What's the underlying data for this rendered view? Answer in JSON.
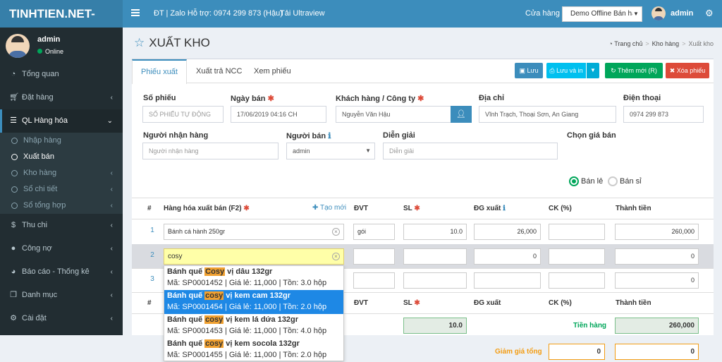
{
  "topbar": {
    "logo": "TINHTIEN.NET-Sales",
    "hotline": "ĐT | Zalo Hỗ trợ: 0974 299 873 (Hậu)",
    "ultraview": "Tải Ultraview",
    "store_label": "Cửa hàng",
    "store_value": "Demo Offline Bán hàn",
    "user": "admin"
  },
  "sidebar": {
    "user_name": "admin",
    "user_status": "Online",
    "menu": [
      {
        "label": "Tổng quan",
        "icon": "dashboard-icon"
      },
      {
        "label": "Đặt hàng",
        "icon": "cart-icon"
      },
      {
        "label": "QL Hàng hóa",
        "icon": "list-icon"
      },
      {
        "label": "Thu chi",
        "icon": "dollar-icon"
      },
      {
        "label": "Công nợ",
        "icon": "users-icon"
      },
      {
        "label": "Báo cáo - Thống kê",
        "icon": "pie-chart-icon"
      },
      {
        "label": "Danh mục",
        "icon": "copy-icon"
      },
      {
        "label": "Cài đặt",
        "icon": "gear-icon"
      }
    ],
    "submenu": [
      "Nhập hàng",
      "Xuất bán",
      "Kho hàng",
      "Sổ chi tiết",
      "Sổ tổng hợp"
    ]
  },
  "page": {
    "title": "XUẤT KHO",
    "breadcrumb": [
      "Trang chủ",
      "Kho hàng",
      "Xuất kho"
    ]
  },
  "tabs": [
    "Phiếu xuất",
    "Xuất trả NCC",
    "Xem phiếu"
  ],
  "buttons": {
    "save": "Lưu",
    "save_print": "Lưu và in",
    "add_new": "Thêm mới (R)",
    "delete": "Xóa phiếu"
  },
  "form": {
    "so_phieu": {
      "label": "Số phiếu",
      "placeholder": "SỐ PHIẾU TỰ ĐỘNG"
    },
    "ngay_ban": {
      "label": "Ngày bán",
      "value": "17/06/2019 04:16 CH"
    },
    "khach_hang": {
      "label": "Khách hàng / Công ty",
      "value": "Nguyễn Văn Hậu"
    },
    "dia_chi": {
      "label": "Địa chỉ",
      "value": "Vĩnh Trạch, Thoại Sơn, An Giang"
    },
    "dien_thoai": {
      "label": "Điện thoại",
      "value": "0974 299 873"
    },
    "nguoi_nhan": {
      "label": "Người nhận hàng",
      "placeholder": "Người nhận hàng"
    },
    "nguoi_ban": {
      "label": "Người bán",
      "value": "admin"
    },
    "dien_giai": {
      "label": "Diễn giải",
      "placeholder": "Diễn giải"
    },
    "chon_gia": {
      "label": "Chọn giá bán",
      "options": [
        "Bán lẻ",
        "Bán sỉ"
      ],
      "selected": "Bán lẻ"
    }
  },
  "table": {
    "headers": {
      "num": "#",
      "product": "Hàng hóa xuất bán (F2)",
      "add_link": "Tạo mới",
      "unit": "ĐVT",
      "qty": "SL",
      "price": "ĐG xuất",
      "discount": "CK (%)",
      "total": "Thành tiền"
    },
    "rows": [
      {
        "num": "1",
        "product": "Bánh cá hành 250gr",
        "unit": "gói",
        "qty": "10.0",
        "price": "26,000",
        "discount": "",
        "total": "260,000"
      },
      {
        "num": "2",
        "product": "cosy",
        "unit": "",
        "qty": "",
        "price": "0",
        "discount": "",
        "total": "0"
      },
      {
        "num": "3",
        "product": "",
        "unit": "",
        "qty": "",
        "price": "",
        "discount": "",
        "total": "0"
      }
    ],
    "footer": {
      "qty_total": "10.0",
      "tien_hang_label": "Tiền hàng",
      "tien_hang": "260,000",
      "giam_gia_label": "Giảm giá tổng",
      "giam_gia_pct": "0",
      "giam_gia": "0"
    }
  },
  "suggestions": [
    {
      "pre": "Bánh quế ",
      "hl": "Cosy",
      "post": " vị dâu 132gr",
      "meta": "Mã: SP0001452 | Giá lẻ: 11,000 | Tồn: 3.0 hộp"
    },
    {
      "pre": "Bánh quế ",
      "hl": "cosy",
      "post": " vị kem cam 132gr",
      "meta": "Mã: SP0001454 | Giá lẻ: 11,000 | Tồn: 2.0 hộp"
    },
    {
      "pre": "Bánh quế ",
      "hl": "cosy",
      "post": " vị kem lá dứa 132gr",
      "meta": "Mã: SP0001453 | Giá lẻ: 11,000 | Tồn: 4.0 hộp"
    },
    {
      "pre": "Bánh quế ",
      "hl": "cosy",
      "post": " vị kem socola 132gr",
      "meta": "Mã: SP0001455 | Giá lẻ: 11,000 | Tồn: 2.0 hộp"
    }
  ],
  "colors": {
    "primary": "#3c8dbc",
    "success": "#00a65a",
    "danger": "#dd4b39",
    "sidebar": "#222d32"
  }
}
